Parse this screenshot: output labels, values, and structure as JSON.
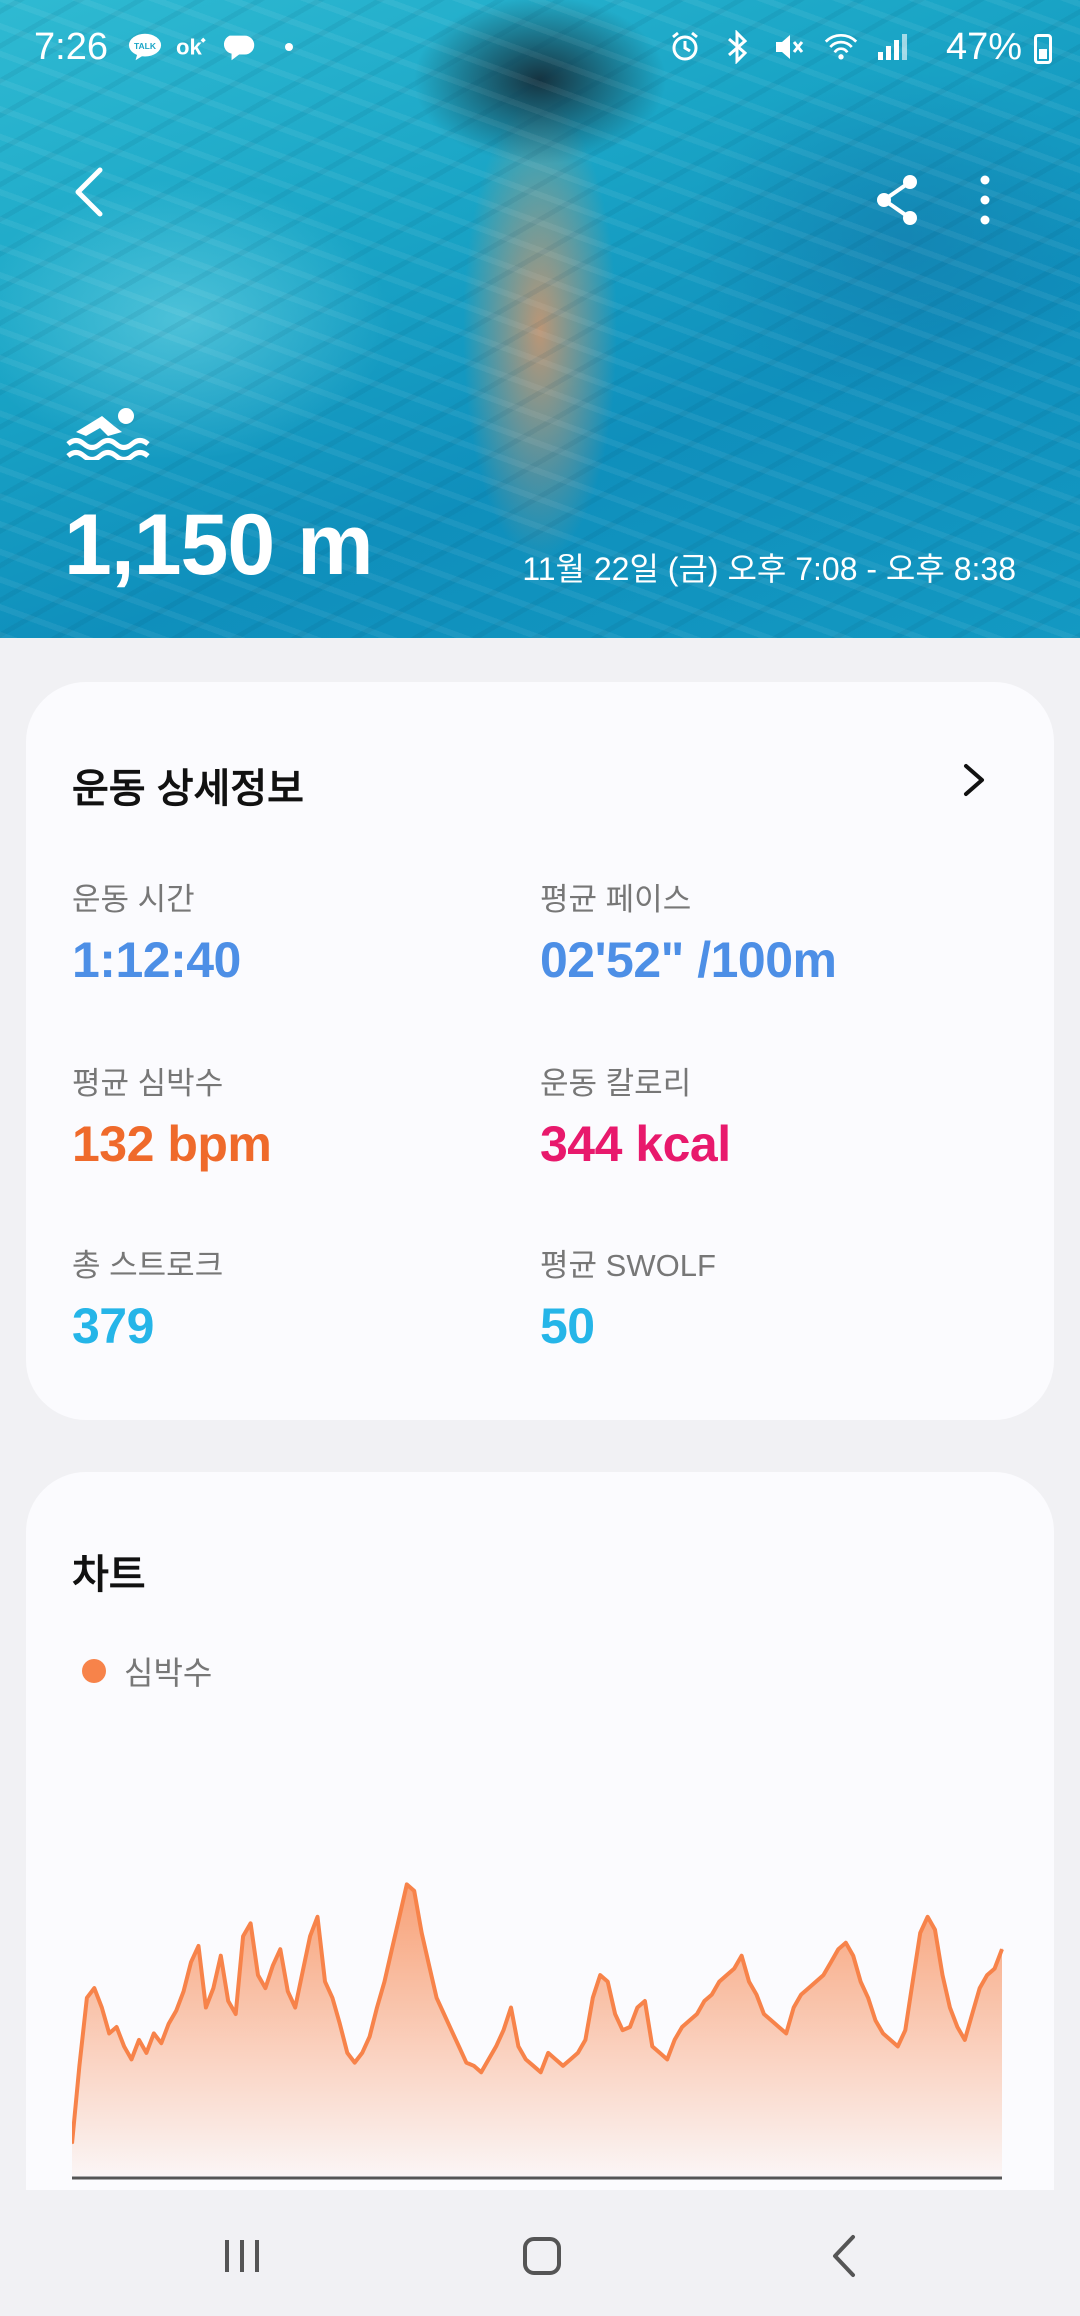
{
  "status_bar": {
    "time": "7:26",
    "notification_icons": [
      "kakaotalk-icon",
      "ok-icon",
      "messenger-icon",
      "dot-icon"
    ],
    "system_icons": [
      "alarm-icon",
      "bluetooth-icon",
      "mute-icon",
      "wifi-icon",
      "signal-icon"
    ],
    "battery": "47%"
  },
  "header": {
    "activity_icon": "swimming-icon",
    "distance": "1,150 m",
    "date_range": "11월 22일 (금) 오후 7:08 - 오후 8:38"
  },
  "details": {
    "title": "운동 상세정보",
    "metrics": [
      {
        "label": "운동 시간",
        "value": "1:12:40",
        "color": "#4d8fe6"
      },
      {
        "label": "평균 페이스",
        "value": "02'52\" /100m",
        "color": "#4d8fe6"
      },
      {
        "label": "평균 심박수",
        "value": "132 bpm",
        "color": "#ef6a2b"
      },
      {
        "label": "운동 칼로리",
        "value": "344 kcal",
        "color": "#e8196c"
      },
      {
        "label": "총 스트로크",
        "value": "379",
        "color": "#25b5e8"
      },
      {
        "label": "평균 SWOLF",
        "value": "50",
        "color": "#25b5e8"
      }
    ]
  },
  "chart": {
    "title": "차트",
    "legend": "심박수",
    "legend_color": "#f7834a"
  },
  "chart_data": {
    "type": "area",
    "series": [
      {
        "name": "심박수",
        "values": [
          10,
          34,
          55,
          58,
          52,
          44,
          46,
          40,
          36,
          42,
          38,
          44,
          41,
          47,
          51,
          57,
          66,
          71,
          52,
          58,
          68,
          54,
          50,
          74,
          78,
          62,
          58,
          65,
          70,
          57,
          52,
          63,
          74,
          80,
          60,
          55,
          47,
          38,
          35,
          38,
          43,
          52,
          60,
          70,
          80,
          90,
          88,
          75,
          65,
          55,
          50,
          45,
          40,
          35,
          34,
          32,
          36,
          40,
          45,
          52,
          40,
          36,
          34,
          32,
          38,
          36,
          34,
          36,
          38,
          42,
          55,
          62,
          60,
          50,
          45,
          46,
          52,
          54,
          40,
          38,
          36,
          42,
          46,
          48,
          50,
          54,
          56,
          60,
          62,
          64,
          68,
          60,
          56,
          50,
          48,
          46,
          44,
          52,
          56,
          58,
          60,
          62,
          66,
          70,
          72,
          68,
          60,
          55,
          48,
          44,
          42,
          40,
          45,
          60,
          75,
          80,
          76,
          62,
          52,
          46,
          42,
          50,
          58,
          62,
          64,
          70
        ]
      }
    ],
    "ylim": [
      0,
      100
    ],
    "grid": false
  }
}
